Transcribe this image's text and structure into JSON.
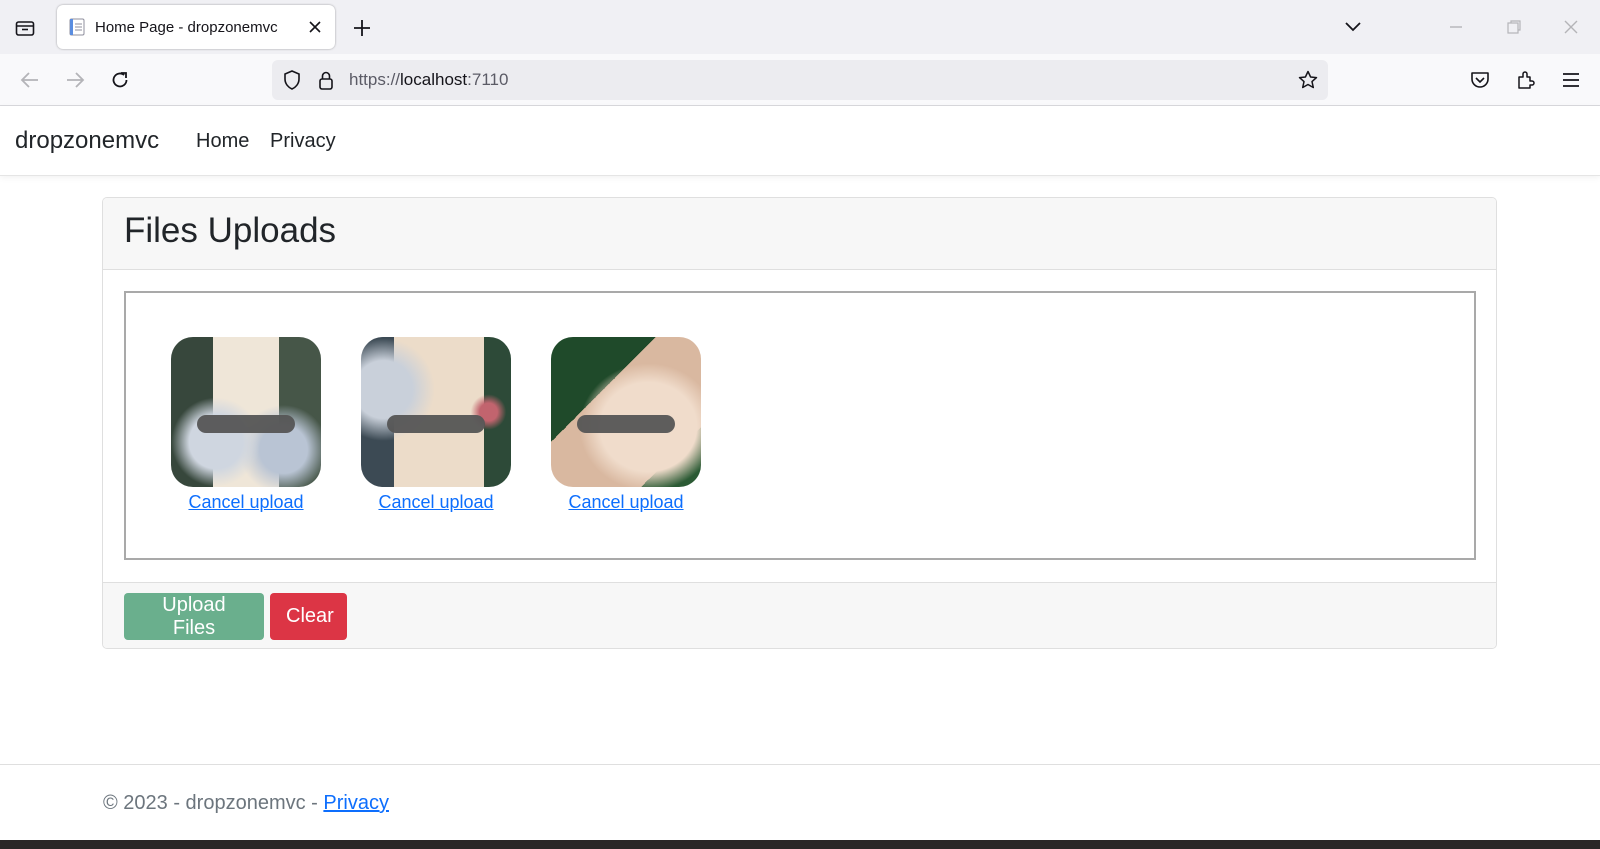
{
  "browser": {
    "tab_title": "Home Page - dropzonemvc",
    "url_scheme": "https://",
    "url_host": "localhost",
    "url_port": ":7110"
  },
  "site": {
    "brand": "dropzonemvc",
    "nav": [
      {
        "label": "Home"
      },
      {
        "label": "Privacy"
      }
    ]
  },
  "uploads": {
    "title": "Files Uploads",
    "previews": [
      {
        "cancel_label": "Cancel upload",
        "thumbnail": "photo-thumbnail"
      },
      {
        "cancel_label": "Cancel upload",
        "thumbnail": "photo-thumbnail"
      },
      {
        "cancel_label": "Cancel upload",
        "thumbnail": "photo-thumbnail"
      }
    ],
    "upload_button": "Upload Files",
    "clear_button": "Clear"
  },
  "footer": {
    "copyright": "© 2023 - dropzonemvc - ",
    "privacy_link": "Privacy"
  },
  "colors": {
    "upload_button": "#6aaf8d",
    "clear_button": "#dc3545",
    "link": "#0d6efd"
  }
}
